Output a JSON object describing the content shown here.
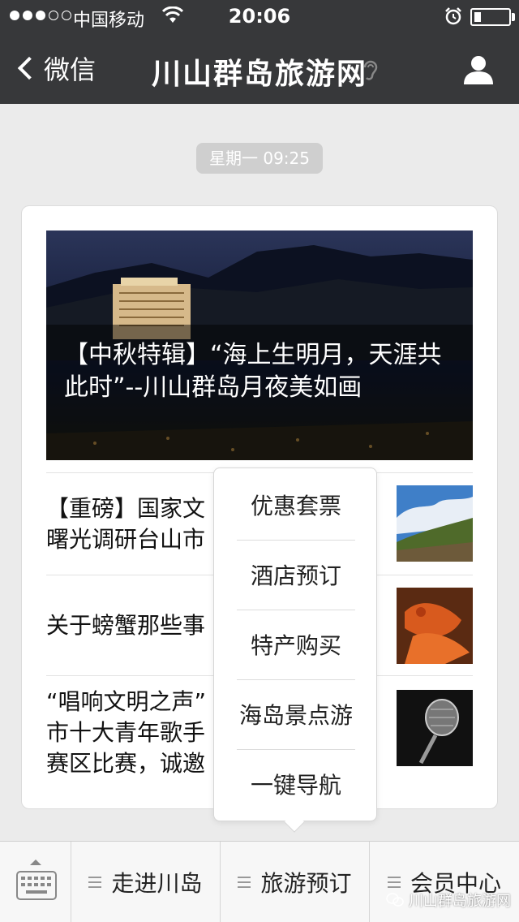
{
  "status_bar": {
    "carrier": "中国移动",
    "time": "20:06",
    "signal": {
      "filled": 3,
      "empty": 2
    }
  },
  "nav": {
    "back_label": "微信",
    "title": "川山群岛旅游网"
  },
  "timestamp": "星期一 09:25",
  "article_card": {
    "hero": {
      "title": "【中秋特辑】“海上生明月，天涯共此时”--川山群岛月夜美如画"
    },
    "items": [
      {
        "title": "【重磅】国家文\n曙光调研台山市"
      },
      {
        "title": "关于螃蟹那些事"
      },
      {
        "title": "“唱响文明之声”\n市十大青年歌手\n赛区比赛，诚邀"
      }
    ]
  },
  "popup_menu": {
    "items": [
      "优惠套票",
      "酒店预订",
      "特产购买",
      "海岛景点游",
      "一键导航"
    ]
  },
  "bottom_menu": {
    "items": [
      "走进川岛",
      "旅游预订",
      "会员中心"
    ]
  },
  "watermark": "川山群岛旅游网",
  "colors": {
    "header_bg": "#37383a",
    "page_bg": "#ebebeb",
    "menubar_bg": "#f7f7f7"
  }
}
